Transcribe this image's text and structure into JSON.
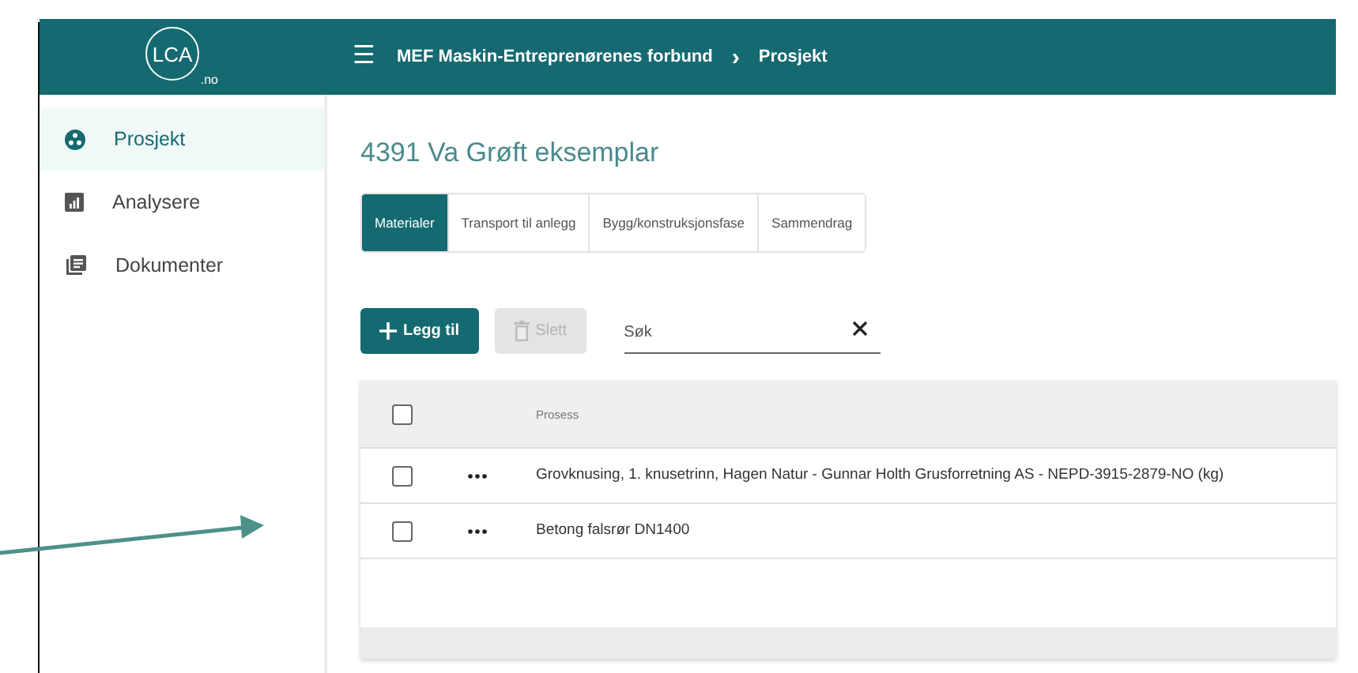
{
  "header": {
    "logo": {
      "main": "LCA",
      "sub": ".no"
    },
    "menu_icon": "☰",
    "breadcrumb": [
      {
        "label": "MEF Maskin-Entreprenørenes forbund"
      },
      {
        "label": "Prosjekt"
      }
    ],
    "separator": "›"
  },
  "sidebar": {
    "items": [
      {
        "label": "Prosjekt",
        "kind": "project",
        "selected": true
      },
      {
        "label": "Analysere",
        "kind": "chart",
        "selected": false
      },
      {
        "label": "Dokumenter",
        "kind": "docs",
        "selected": false
      }
    ]
  },
  "page": {
    "title": "4391 Va Grøft eksemplar"
  },
  "tabs": [
    {
      "label": "Materialer",
      "selected": true
    },
    {
      "label": "Transport til anlegg",
      "selected": false
    },
    {
      "label": "Bygg/konstruksjonsfase",
      "selected": false
    },
    {
      "label": "Sammendrag",
      "selected": false
    }
  ],
  "toolbar": {
    "buttons": [
      {
        "label": "Legg til",
        "kind": "add",
        "disabled": false
      },
      {
        "label": "Slett",
        "kind": "delete",
        "disabled": true
      }
    ],
    "search": {
      "placeholder": "Søk"
    }
  },
  "table": {
    "header": {
      "checked": false,
      "column": "Prosess"
    },
    "rows": [
      {
        "checked": false,
        "prosess": "Grovknusing, 1. knusetrinn, Hagen Natur - Gunnar Holth Grusforretning AS - NEPD-3915-2879-NO (kg)"
      },
      {
        "checked": false,
        "prosess": "Betong falsrør DN1400"
      }
    ]
  }
}
